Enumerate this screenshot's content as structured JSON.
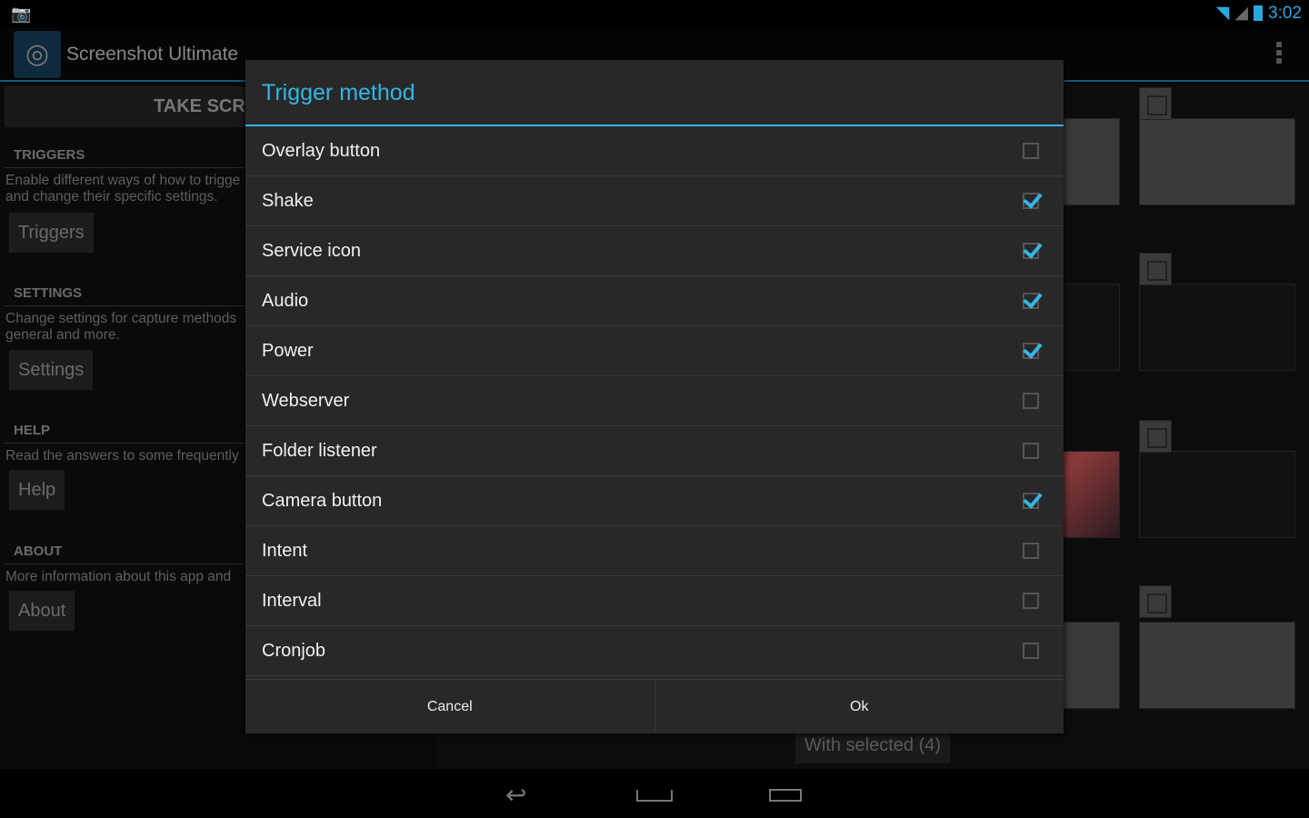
{
  "status": {
    "time": "3:02"
  },
  "app": {
    "title": "Screenshot Ultimate"
  },
  "left": {
    "take_button": "TAKE SCREEN",
    "sections": [
      {
        "header": "TRIGGERS",
        "desc": "Enable different ways of how to trigge\nand change their specific settings.",
        "button": "Triggers"
      },
      {
        "header": "SETTINGS",
        "desc": "Change settings for capture methods\ngeneral and more.",
        "button": "Settings"
      },
      {
        "header": "HELP",
        "desc": "Read the answers to some frequently",
        "button": "Help"
      },
      {
        "header": "ABOUT",
        "desc": "More information about this app and",
        "button": "About"
      }
    ]
  },
  "gallery": {
    "with_selected": "With selected (4)"
  },
  "dialog": {
    "title": "Trigger method",
    "items": [
      {
        "label": "Overlay button",
        "checked": false
      },
      {
        "label": "Shake",
        "checked": true
      },
      {
        "label": "Service icon",
        "checked": true
      },
      {
        "label": "Audio",
        "checked": true
      },
      {
        "label": "Power",
        "checked": true
      },
      {
        "label": "Webserver",
        "checked": false
      },
      {
        "label": "Folder listener",
        "checked": false
      },
      {
        "label": "Camera button",
        "checked": true
      },
      {
        "label": "Intent",
        "checked": false
      },
      {
        "label": "Interval",
        "checked": false
      },
      {
        "label": "Cronjob",
        "checked": false
      }
    ],
    "cancel": "Cancel",
    "ok": "Ok"
  },
  "colors": {
    "accent": "#33b5e5"
  }
}
